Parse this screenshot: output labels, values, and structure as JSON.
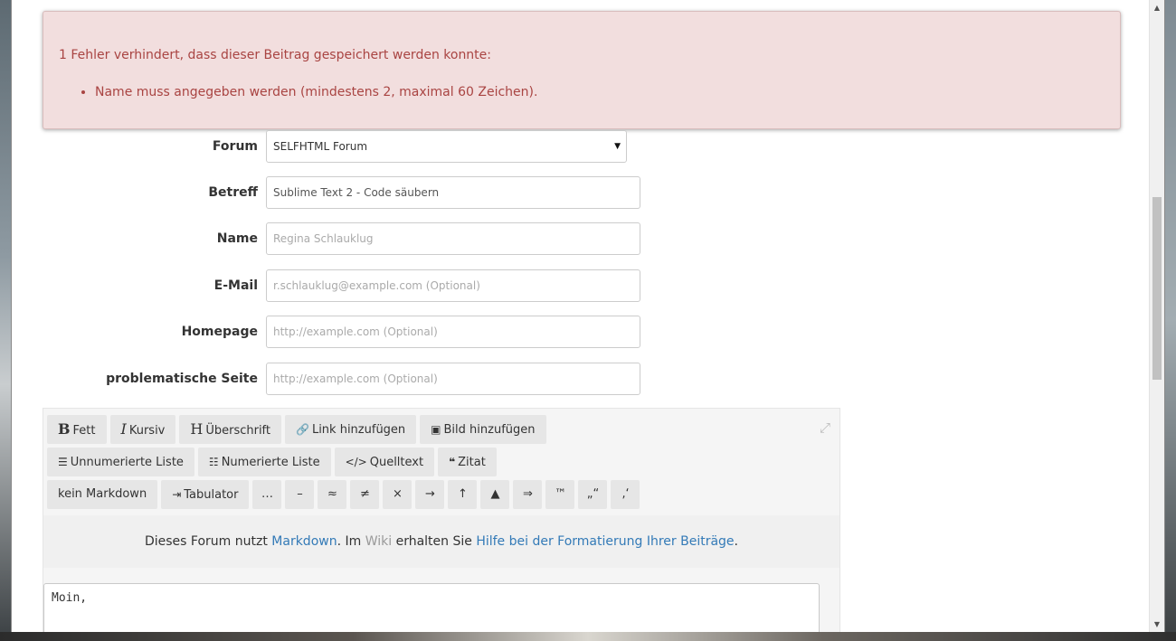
{
  "alert": {
    "title": "1 Fehler verhindert, dass dieser Beitrag gespeichert werden konnte:",
    "errors": [
      "Name muss angegeben werden (mindestens 2, maximal 60 Zeichen)."
    ]
  },
  "form": {
    "forum": {
      "label": "Forum",
      "value": "SELFHTML Forum"
    },
    "betreff": {
      "label": "Betreff",
      "value": "Sublime Text 2 - Code säubern"
    },
    "name": {
      "label": "Name",
      "placeholder": "Regina Schlauklug"
    },
    "email": {
      "label": "E-Mail",
      "placeholder": "r.schlauklug@example.com (Optional)"
    },
    "homepage": {
      "label": "Homepage",
      "placeholder": "http://example.com (Optional)"
    },
    "problem_page": {
      "label": "problematische Seite",
      "placeholder": "http://example.com (Optional)"
    }
  },
  "toolbar": {
    "bold": "Fett",
    "italic": "Kursiv",
    "heading": "Überschrift",
    "link": "Link hinzufügen",
    "image": "Bild hinzufügen",
    "ulist": "Unnumerierte Liste",
    "olist": "Numerierte Liste",
    "code": "Quelltext",
    "quote": "Zitat",
    "no_markdown": "kein Markdown",
    "tab": "Tabulator",
    "symbols": [
      "…",
      "–",
      "≈",
      "≠",
      "×",
      "→",
      "↑",
      "▲",
      "⇒",
      "™",
      "„“",
      "‚‘"
    ]
  },
  "info": {
    "prefix": "Dieses Forum nutzt ",
    "markdown_link": "Markdown",
    "middle1": ". Im ",
    "wiki_link": "Wiki",
    "middle2": " erhalten Sie ",
    "help_link": "Hilfe bei der Formatierung Ihrer Beiträge",
    "suffix": "."
  },
  "body_text": "Moin,",
  "colors": {
    "alert_bg": "#f2dede",
    "alert_text": "#a94442",
    "link": "#337ab7"
  }
}
